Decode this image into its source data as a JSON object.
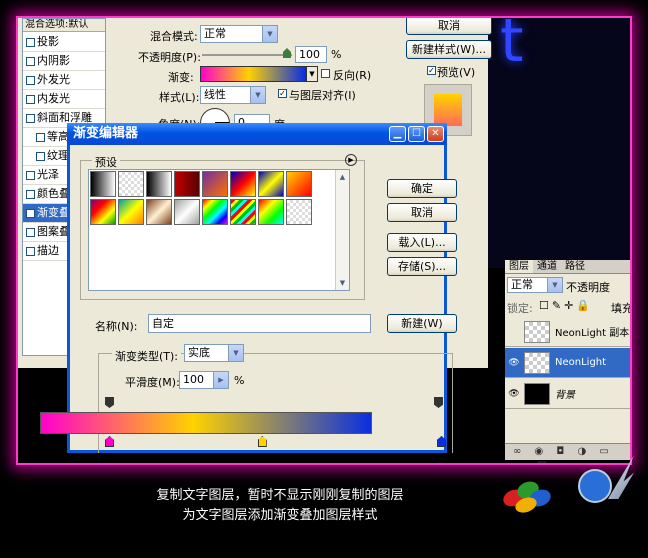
{
  "layer_style": {
    "list_header": "混合选项:默认",
    "effects": [
      {
        "label": "投影",
        "checked": false,
        "indent": false
      },
      {
        "label": "内阴影",
        "checked": false,
        "indent": false
      },
      {
        "label": "外发光",
        "checked": false,
        "indent": false
      },
      {
        "label": "内发光",
        "checked": false,
        "indent": false
      },
      {
        "label": "斜面和浮雕",
        "checked": false,
        "indent": false
      },
      {
        "label": "等高线",
        "checked": false,
        "indent": true
      },
      {
        "label": "纹理",
        "checked": false,
        "indent": true
      },
      {
        "label": "光泽",
        "checked": false,
        "indent": false
      },
      {
        "label": "颜色叠加",
        "checked": false,
        "indent": false
      },
      {
        "label": "渐变叠加",
        "checked": true,
        "indent": false
      },
      {
        "label": "图案叠加",
        "checked": false,
        "indent": false
      },
      {
        "label": "描边",
        "checked": false,
        "indent": false
      }
    ],
    "blend_mode_label": "混合模式:",
    "blend_mode_value": "正常",
    "opacity_label": "不透明度(P):",
    "opacity_value": "100",
    "opacity_unit": "%",
    "gradient_label": "渐变:",
    "reverse_label": "反向(R)",
    "style_label": "样式(L):",
    "style_value": "线性",
    "align_label": "与图层对齐(I)",
    "angle_label": "角度(N):",
    "angle_value": "0",
    "angle_unit": "度",
    "cancel_button": "取消",
    "new_style_button": "新建样式(W)...",
    "preview_label": "预览(V)"
  },
  "gradient_editor": {
    "title": "渐变编辑器",
    "presets_label": "预设",
    "ok_button": "确定",
    "cancel_button": "取消",
    "load_button": "载入(L)...",
    "save_button": "存储(S)...",
    "name_label": "名称(N):",
    "name_value": "自定",
    "new_button": "新建(W)",
    "gradient_type_label": "渐变类型(T):",
    "gradient_type_value": "实底",
    "smoothness_label": "平滑度(M):",
    "smoothness_value": "100",
    "smoothness_unit": "%",
    "gradient_stops": [
      {
        "position": 0,
        "color": "#ff00cc"
      },
      {
        "position": 0.46,
        "color": "#ffd200"
      },
      {
        "position": 1,
        "color": "#0a2fe0"
      }
    ]
  },
  "layers_panel": {
    "tabs": [
      "图层",
      "通道",
      "路径"
    ],
    "blend_mode": "正常",
    "opacity_label": "不透明度",
    "lock_label": "锁定:",
    "fill_label": "填充",
    "layers": [
      {
        "name": "NeonLight 副本",
        "visible": false,
        "selected": false
      },
      {
        "name": "NeonLight",
        "visible": true,
        "selected": true
      },
      {
        "name": "背景",
        "visible": true,
        "selected": false
      }
    ]
  },
  "canvas_text": "t",
  "caption": {
    "line1": "复制文字图层，暂时不显示刚刚复制的图层",
    "line2": "为文字图层添加渐变叠加图层样式"
  },
  "colors": {
    "accent_glow": "#ff3cc8",
    "title_bar": "#0054e3",
    "selection": "#316ac5"
  }
}
